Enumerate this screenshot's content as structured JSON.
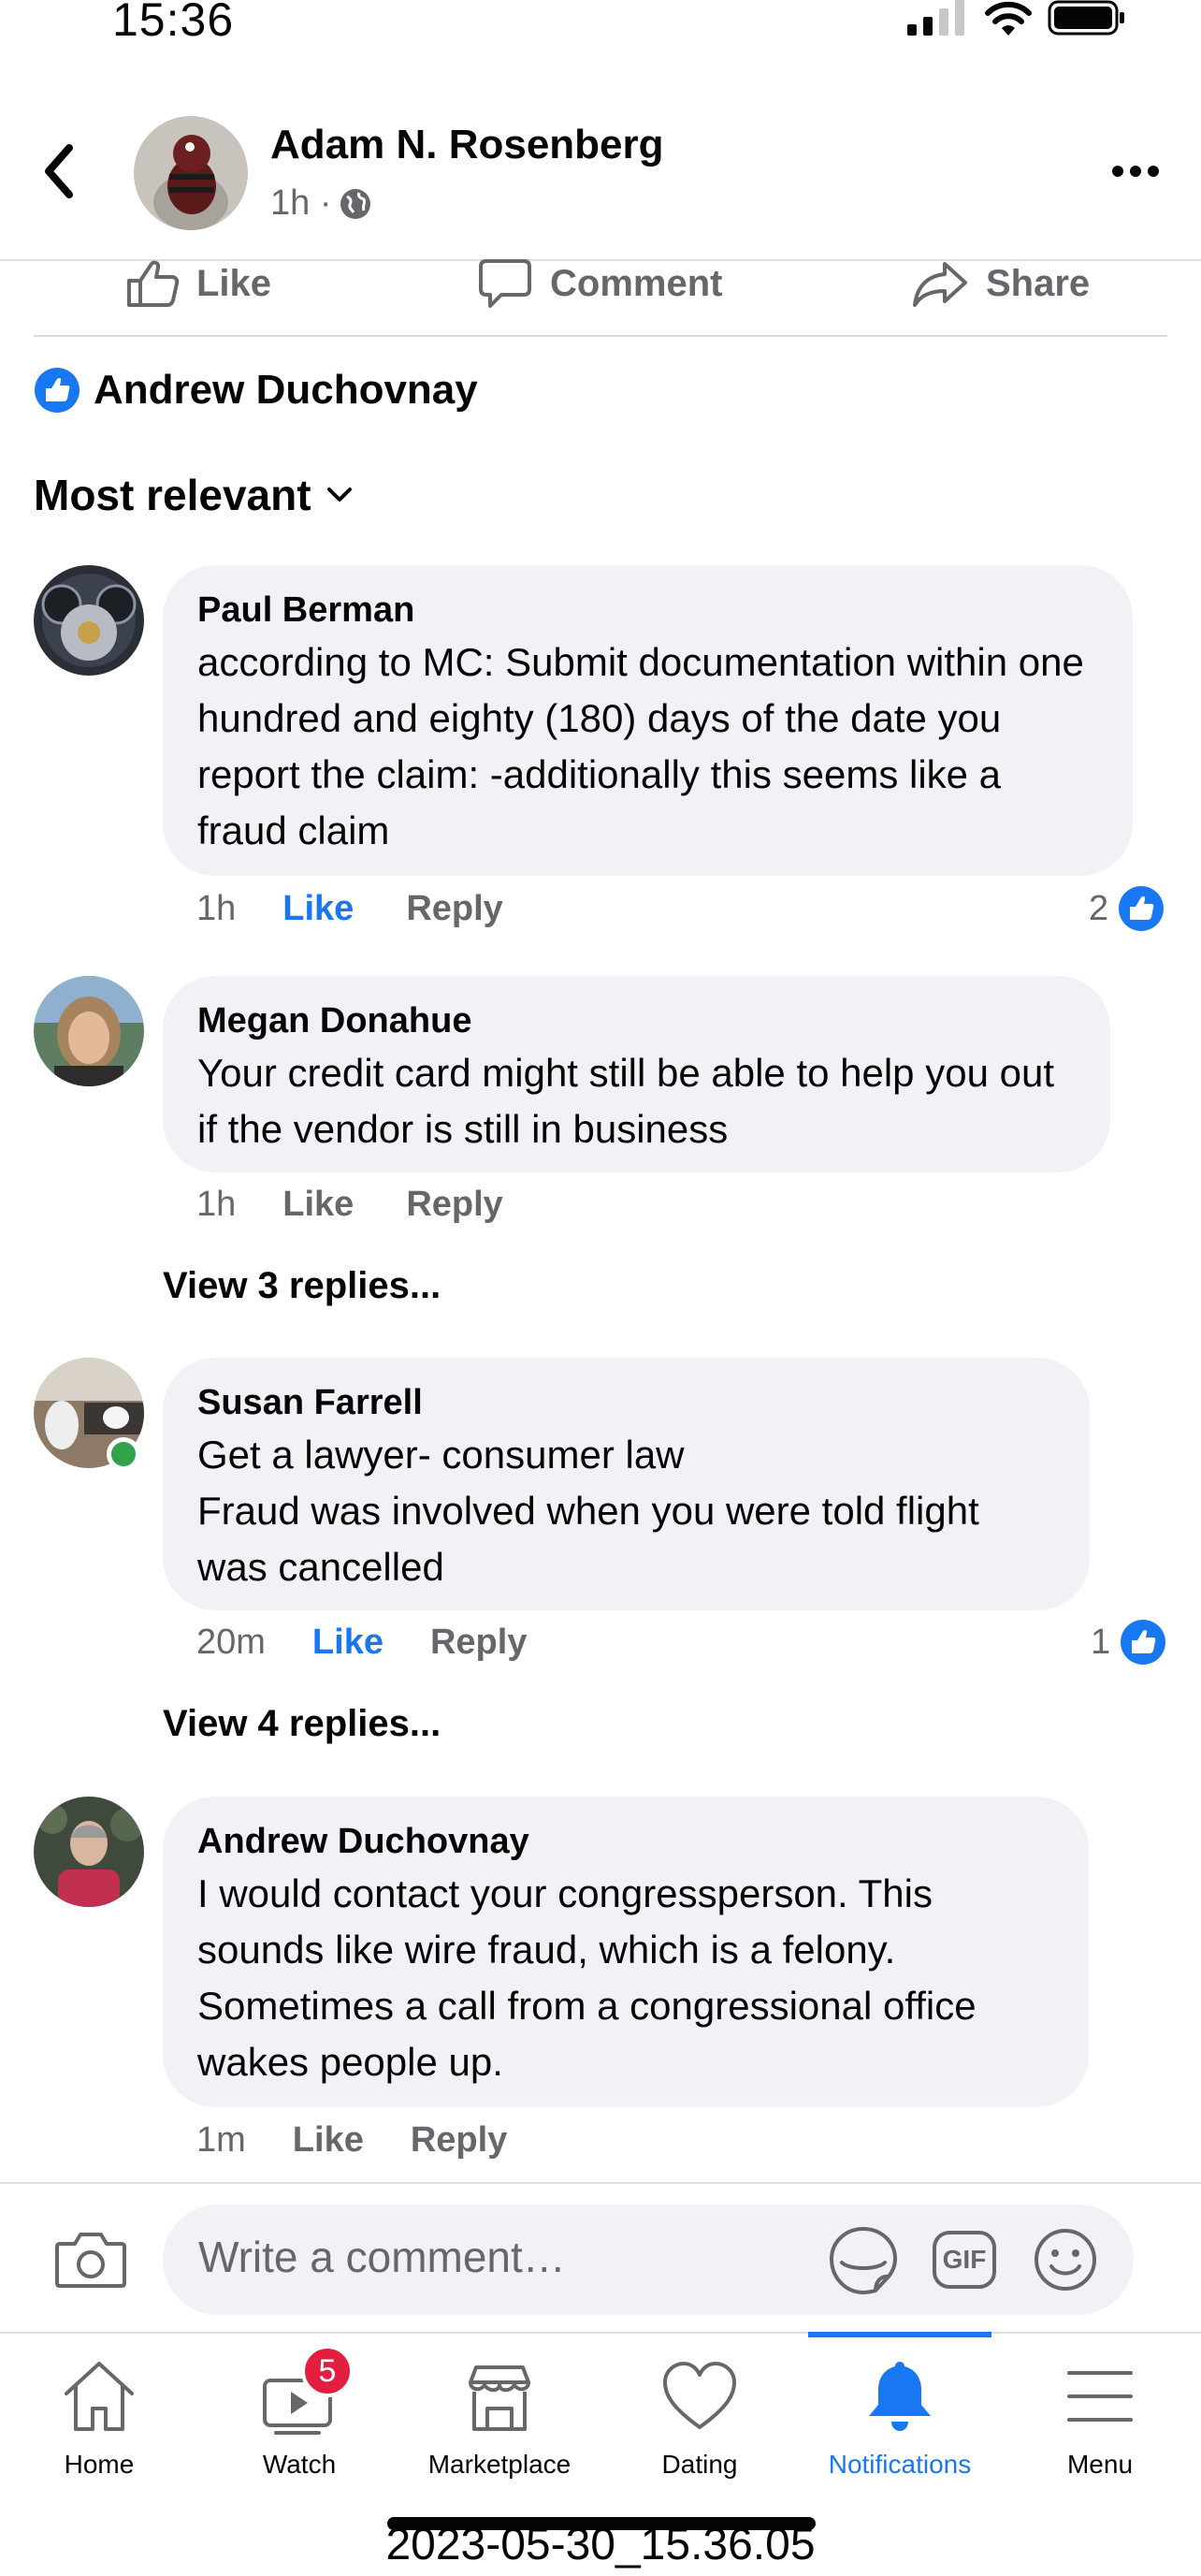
{
  "status_bar": {
    "time": "15:36"
  },
  "header": {
    "author_name": "Adam N. Rosenberg",
    "meta_time": "1h ·",
    "privacy_icon": "globe-icon"
  },
  "actions": {
    "like": "Like",
    "comment": "Comment",
    "share": "Share"
  },
  "reactor": {
    "name": "Andrew Duchovnay"
  },
  "sort": {
    "label": "Most relevant"
  },
  "comments": [
    {
      "name": "Paul Berman",
      "text": "according to MC: Submit documentation within one hundred and eighty (180) days of the date you report the claim: -additionally this seems like a fraud claim",
      "time": "1h",
      "like": "Like",
      "reply": "Reply",
      "liked": true,
      "reactions": "2"
    },
    {
      "name": "Megan Donahue",
      "text": "Your credit card might still be able to help you out if the vendor is still in business",
      "time": "1h",
      "like": "Like",
      "reply": "Reply",
      "liked": false,
      "view_replies": "View 3 replies..."
    },
    {
      "name": "Susan Farrell",
      "text": "Get a lawyer- consumer law\nFraud was involved when you were told flight was cancelled",
      "time": "20m",
      "like": "Like",
      "reply": "Reply",
      "liked": true,
      "reactions": "1",
      "view_replies": "View 4 replies...",
      "online": true
    },
    {
      "name": "Andrew Duchovnay",
      "text": "I would contact your congressperson. This sounds like wire fraud, which is a felony. Sometimes a call from a congressional office wakes people up.",
      "time": "1m",
      "like": "Like",
      "reply": "Reply",
      "liked": false
    }
  ],
  "composer": {
    "placeholder": "Write a comment…",
    "gif": "GIF"
  },
  "tabs": [
    {
      "label": "Home",
      "icon": "home-icon"
    },
    {
      "label": "Watch",
      "icon": "watch-icon",
      "badge": "5"
    },
    {
      "label": "Marketplace",
      "icon": "marketplace-icon"
    },
    {
      "label": "Dating",
      "icon": "dating-icon"
    },
    {
      "label": "Notifications",
      "icon": "bell-icon",
      "active": true
    },
    {
      "label": "Menu",
      "icon": "menu-icon"
    }
  ],
  "footer": {
    "timestamp": "2023-05-30_15.36.05"
  },
  "colors": {
    "accent": "#1877f2",
    "secondary_text": "#65676b",
    "bubble": "#f0f2f5",
    "badge": "#e41e3f",
    "online": "#31a24c"
  }
}
